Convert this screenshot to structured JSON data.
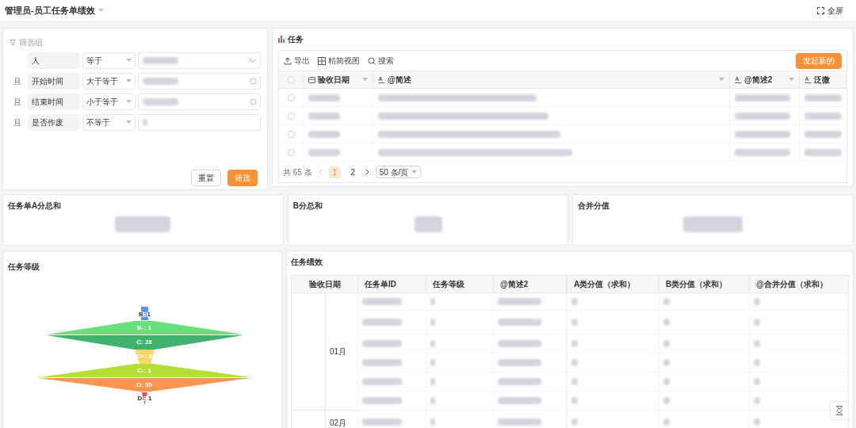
{
  "header": {
    "title": "管理员-员工任务单绩效",
    "fullscreen": "全屏"
  },
  "filter": {
    "title": "筛选组",
    "rows": [
      {
        "field": "人",
        "operator": "等于",
        "kind": "select"
      },
      {
        "connector": "且",
        "field": "开始时间",
        "operator": "大于等于",
        "kind": "date"
      },
      {
        "connector": "且",
        "field": "结束时间",
        "operator": "小于等于",
        "kind": "date"
      },
      {
        "connector": "且",
        "field": "是否作废",
        "operator": "不等于",
        "kind": "text"
      }
    ],
    "reset": "重置",
    "submit": "筛选"
  },
  "tasks": {
    "title": "任务",
    "toolbar": [
      {
        "label": "导出",
        "kind": "export"
      },
      {
        "label": "精简视图",
        "kind": "view"
      },
      {
        "label": "搜索",
        "kind": "search"
      }
    ],
    "new_button": "发起新的",
    "columns": [
      {
        "label": "验收日期",
        "kind": "date"
      },
      {
        "label": "@简述",
        "kind": "text"
      },
      {
        "label": "@简述2",
        "kind": "text"
      },
      {
        "label": "泛微",
        "kind": "text"
      }
    ],
    "all_checked": false,
    "rows": [
      {
        "checked": false
      },
      {
        "checked": false
      },
      {
        "checked": false
      },
      {
        "checked": false
      }
    ],
    "total": "共 65 条",
    "pages": [
      {
        "label": "1",
        "selected": true
      },
      {
        "label": "2",
        "selected": false
      }
    ],
    "page_size": "50 条/页"
  },
  "stats": [
    {
      "title": "任务单A分总和"
    },
    {
      "title": "B分总和"
    },
    {
      "title": "合并分值"
    }
  ],
  "grades": {
    "title": "任务等级",
    "segments": [
      {
        "label": "B: 1",
        "color": "#5b8ff9"
      },
      {
        "label": "B-: 1",
        "color": "#66e07a"
      },
      {
        "label": "C: 28",
        "color": "#3fb26e"
      },
      {
        "label": "C+: 3",
        "color": "#ffd666"
      },
      {
        "label": "C-: 1",
        "color": "#b4de34"
      },
      {
        "label": "D: 30",
        "color": "#ff944d"
      },
      {
        "label": "D-: 1",
        "color": "#f0484a"
      }
    ]
  },
  "performance": {
    "title": "任务绩效",
    "columns": [
      "验收日期",
      "任务单ID",
      "任务等级",
      "@简述2",
      "A类分值（求和）",
      "B类分值（求和）",
      "@合并分值（求和）"
    ],
    "groups": [
      {
        "label": "01月"
      },
      {
        "label": "02月"
      }
    ]
  }
}
